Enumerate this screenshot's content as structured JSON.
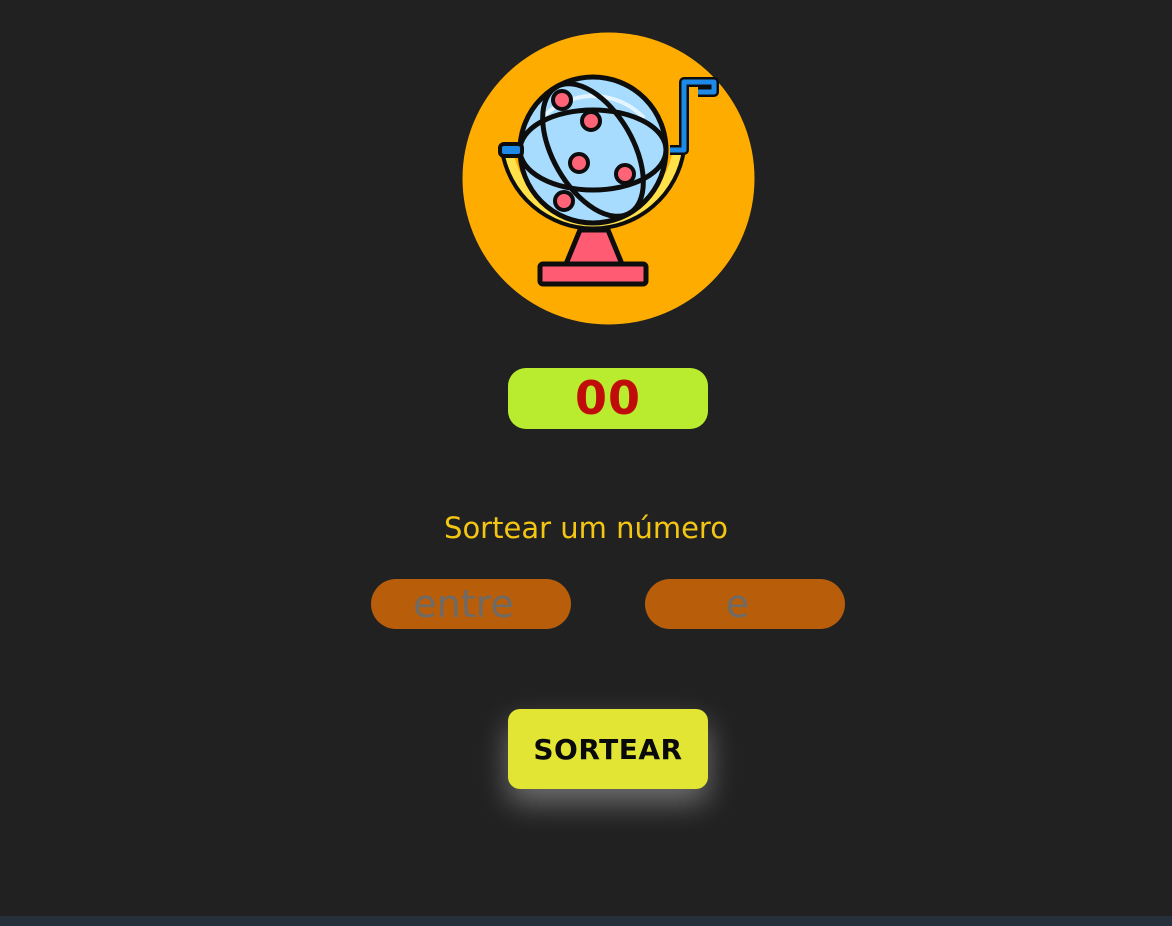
{
  "logo": {
    "icon": "lottery-globe-icon",
    "colors": {
      "circle": "#ffac00",
      "globe": "#a8dcff",
      "ball": "#ff6378",
      "stand": "#ff5b73",
      "outline": "#0d0d0d",
      "crank": "#1e8ae8"
    }
  },
  "result": {
    "value": "00",
    "background": "#b9ec2f",
    "text_color": "#c00d0a"
  },
  "subtitle": {
    "text": "Sortear um número",
    "color": "#f3c613"
  },
  "range": {
    "min_placeholder": "entre",
    "min_value": "",
    "max_placeholder": "e",
    "max_value": ""
  },
  "draw_button": {
    "label": "SORTEAR",
    "background": "#e3e534"
  }
}
